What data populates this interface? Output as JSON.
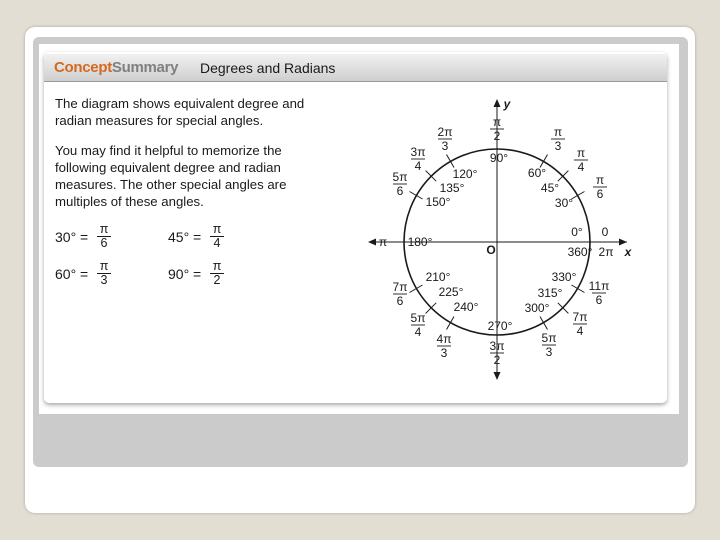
{
  "header": {
    "brand_part1": "Concept",
    "brand_part2": "Summary",
    "title": "Degrees and Radians"
  },
  "intro": {
    "paragraph1": "The diagram shows equivalent degree and radian measures for special angles.",
    "paragraph2": "You may find it helpful to memorize the following equivalent degree and radian measures. The other special angles are multiples of these angles."
  },
  "equivalences": [
    {
      "degrees": "30° =",
      "num": "π",
      "den": "6"
    },
    {
      "degrees": "45° =",
      "num": "π",
      "den": "4"
    },
    {
      "degrees": "60° =",
      "num": "π",
      "den": "3"
    },
    {
      "degrees": "90° =",
      "num": "π",
      "den": "2"
    }
  ],
  "diagram": {
    "axis_y": "y",
    "axis_x": "x",
    "origin": "O",
    "left_pi": "π",
    "degree_labels": [
      "0°",
      "30°",
      "45°",
      "60°",
      "90°",
      "120°",
      "135°",
      "150°",
      "180°",
      "210°",
      "225°",
      "240°",
      "270°",
      "300°",
      "315°",
      "330°",
      "360°"
    ],
    "radian_labels": {
      "zero": "0",
      "two_pi": "2π",
      "pi_over_6": {
        "num": "π",
        "den": "6"
      },
      "pi_over_4": {
        "num": "π",
        "den": "4"
      },
      "pi_over_3": {
        "num": "π",
        "den": "3"
      },
      "pi_over_2": {
        "num": "π",
        "den": "2"
      },
      "two_pi_over_3": {
        "num": "2π",
        "den": "3"
      },
      "three_pi_over_4": {
        "num": "3π",
        "den": "4"
      },
      "five_pi_over_6": {
        "num": "5π",
        "den": "6"
      },
      "seven_pi_over_6": {
        "num": "7π",
        "den": "6"
      },
      "five_pi_over_4": {
        "num": "5π",
        "den": "4"
      },
      "four_pi_over_3": {
        "num": "4π",
        "den": "3"
      },
      "three_pi_over_2": {
        "num": "3π",
        "den": "2"
      },
      "five_pi_over_3": {
        "num": "5π",
        "den": "3"
      },
      "seven_pi_over_4": {
        "num": "7π",
        "den": "4"
      },
      "eleven_pi_over_6": {
        "num": "11π",
        "den": "6"
      }
    }
  }
}
